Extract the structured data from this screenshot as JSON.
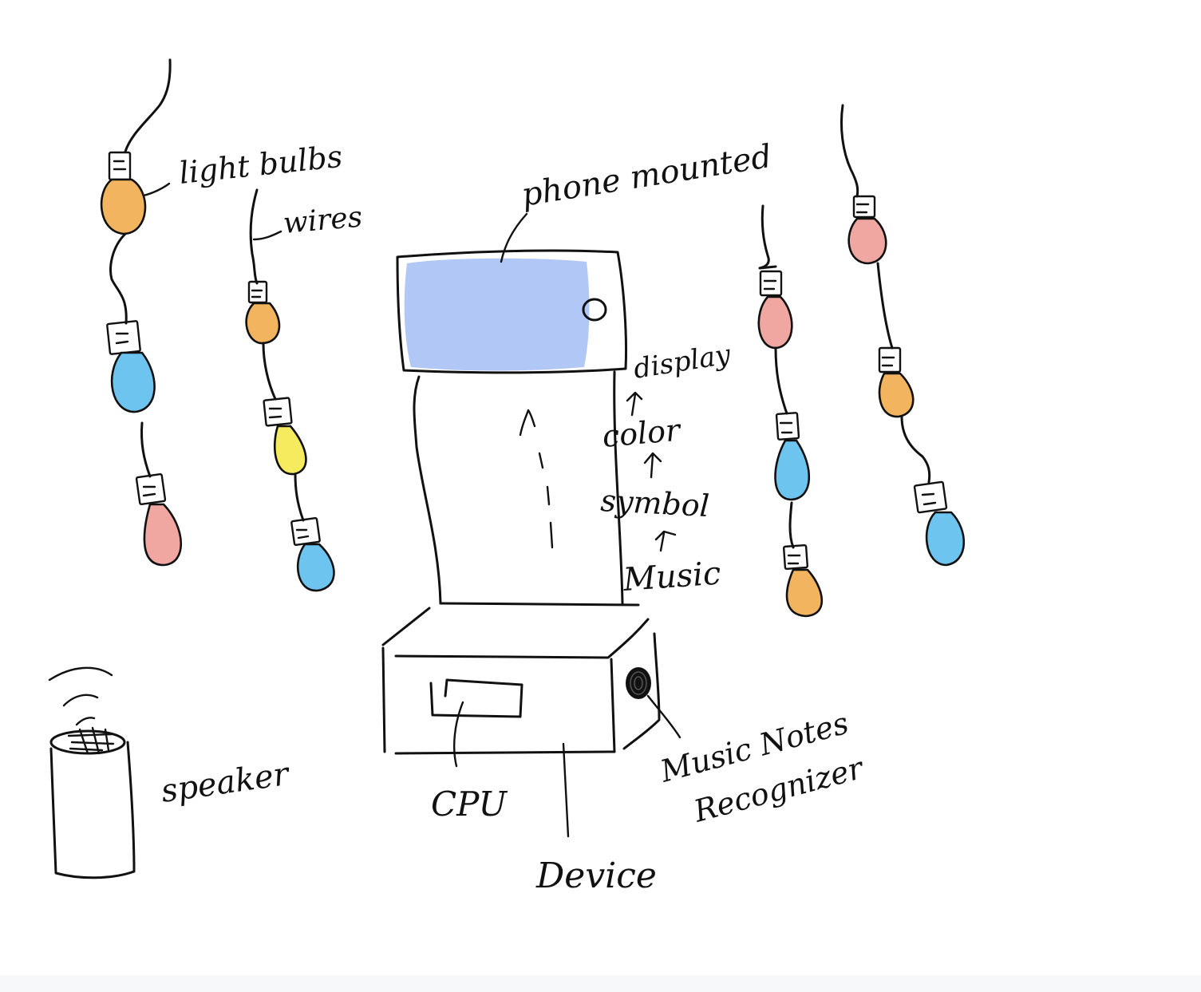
{
  "labels": {
    "light_bulbs": "light bulbs",
    "wires": "wires",
    "phone_mounted": "phone mounted",
    "display": "display",
    "color": "color",
    "symbol": "symbol",
    "music": "Music",
    "speaker": "speaker",
    "cpu": "CPU",
    "device": "Device",
    "recognizer_line1": "Music Notes",
    "recognizer_line2": "Recognizer"
  },
  "colors": {
    "ink": "#111111",
    "screen": "#adc4f5",
    "orange": "#f2b45f",
    "blue": "#6cc4ef",
    "pink": "#f0a7a2",
    "yellow": "#f6ea5f"
  }
}
